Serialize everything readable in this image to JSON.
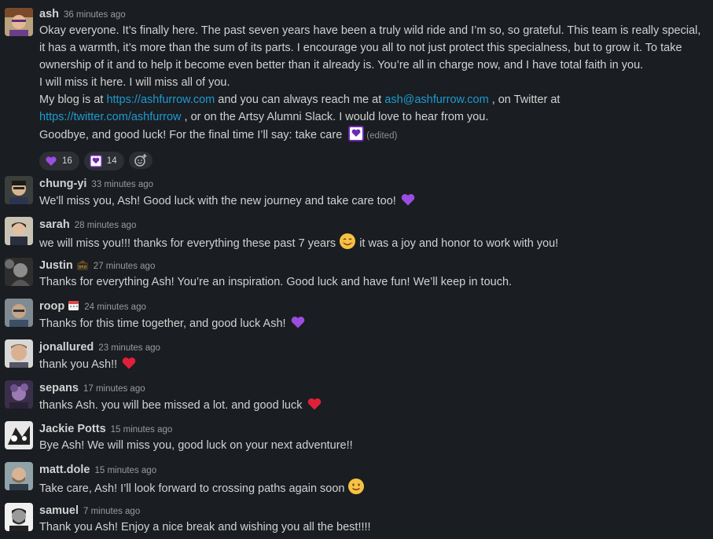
{
  "messages": [
    {
      "user": "ash",
      "time": "36 minutes ago",
      "lines": {
        "l1": "Okay everyone. It’s finally here. The past seven years have been a truly wild ride and I’m so, so grateful. This team is really special, it has a warmth, it’s more than the sum of its parts. I encourage you all to not just protect this specialness, but to grow it. To take ownership of it and to help it become even better than it already is. You’re all in charge now, and I have total faith in you.",
        "l2": "I will miss it here. I will miss all of you.",
        "blog_prefix": "My blog is at",
        "blog_link": "https://ashfurrow.com",
        "reach": "and you can always reach me at",
        "email": "ash@ashfurrow.com",
        "on_twitter": ", on Twitter at",
        "twitter_link": "https://twitter.com/ashfurrow",
        "after_twitter": ", or on the Artsy Alumni Slack. I would love to hear from you.",
        "goodbye": "Goodbye, and good luck! For the final time I’ll say: take care",
        "edited": "(edited)"
      },
      "reactions": [
        {
          "emoji": "purple-heart-icon",
          "count": "16"
        },
        {
          "emoji": "take-care-icon",
          "count": "14"
        }
      ]
    },
    {
      "user": "chung-yi",
      "time": "33 minutes ago",
      "text": "We'll miss you, Ash! Good luck with the new journey and take care too!",
      "emoji": "purple-heart"
    },
    {
      "user": "sarah",
      "time": "28 minutes ago",
      "text_a": "we will miss you!!! thanks for everything these past 7 years",
      "text_b": "it was a joy and honor to work with you!",
      "emoji": "smiling-face"
    },
    {
      "user": "Justin",
      "time": "27 minutes ago",
      "text": "Thanks for everything Ash! You’re an inspiration. Good luck and have fun! We’ll keep in touch.",
      "status": "brb"
    },
    {
      "user": "roop",
      "time": "24 minutes ago",
      "text": "Thanks for this time together, and good luck Ash!",
      "emoji": "purple-heart",
      "status": "calendar"
    },
    {
      "user": "jonallured",
      "time": "23 minutes ago",
      "text": "thank you Ash!!",
      "emoji": "red-heart"
    },
    {
      "user": "sepans",
      "time": "17 minutes ago",
      "text": "thanks Ash. you will bee missed a lot. and good luck",
      "emoji": "red-heart"
    },
    {
      "user": "Jackie Potts",
      "time": "15 minutes ago",
      "text": "Bye Ash! We will miss you, good luck on your next adventure!!"
    },
    {
      "user": "matt.dole",
      "time": "15 minutes ago",
      "text": "Take care, Ash! I’ll look forward to crossing paths again soon",
      "emoji": "slightly-smiling-face"
    },
    {
      "user": "samuel",
      "time": "7 minutes ago",
      "text": "Thank you Ash! Enjoy a nice break and wishing you all the best!!!!"
    }
  ],
  "colors": {
    "background": "#1a1d21",
    "text": "#d1d2d3",
    "link": "#1d9bd1",
    "timestamp": "#9a9b9e",
    "purple_heart": "#9b4de0",
    "red_heart": "#e0203a"
  }
}
